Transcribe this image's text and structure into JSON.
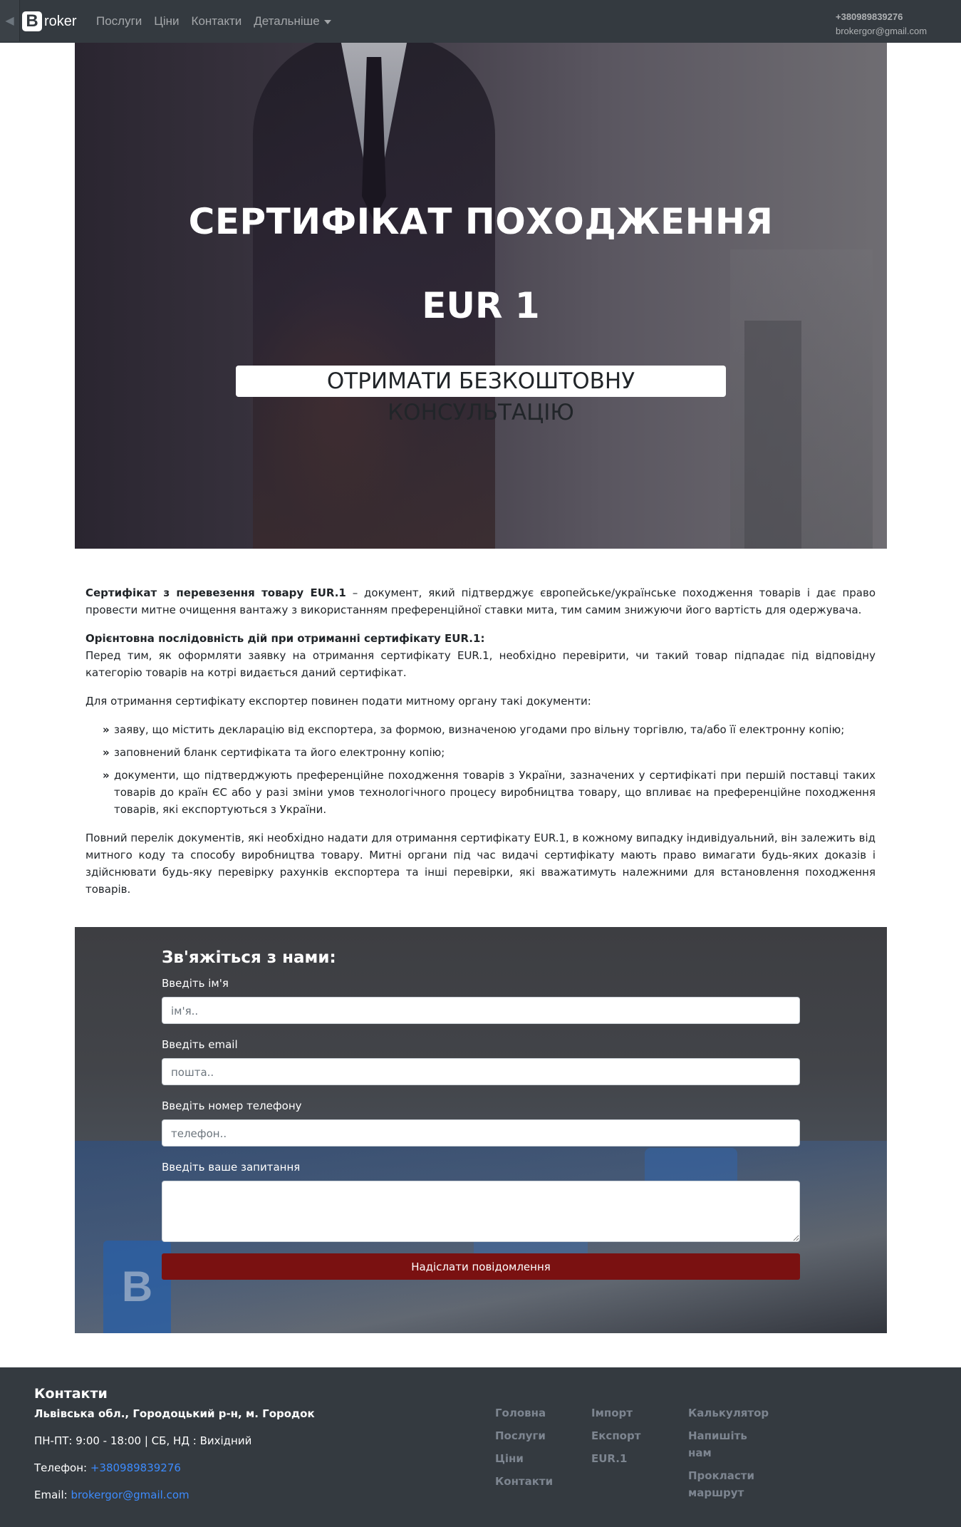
{
  "navbar": {
    "back_icon": "back-arrow-icon",
    "brand_letter": "B",
    "brand_text": "roker",
    "links": [
      "Послуги",
      "Ціни",
      "Контакти",
      "Детальніше"
    ],
    "phone": "+380989839276",
    "email": "brokergor@gmail.com"
  },
  "hero": {
    "title": "СЕРТИФІКАТ ПОХОДЖЕННЯ",
    "subtitle": "EUR 1",
    "cta": "ОТРИМАТИ БЕЗКОШТОВНУ КОНСУЛЬТАЦІЮ"
  },
  "article": {
    "intro_bold": "Сертифікат з перевезення товару EUR.1",
    "intro_text": " – документ, який підтверджує європейське/українське походження товарів і дає право провести митне очищення вантажу з використанням преференційної ставки мита, тим самим знижуючи його вартість для одержувача.",
    "sequence_heading": "Орієнтовна послідовність дій при отриманні сертифікату EUR.1:",
    "p1": "Перед тим, як оформляти заявку на отримання сертифікату EUR.1, необхідно перевірити, чи такий товар підпадає під відповідну категорію товарів на котрі видається даний сертифікат.",
    "p2": "Для отримання сертифікату експортер повинен подати митному органу такі документи:",
    "list": [
      "заяву, що містить декларацію від експортера, за формою, визначеною угодами про вільну торгівлю, та/або її електронну копію;",
      "заповнений бланк сертифіката та його електронну копію;",
      "документи, що підтверджують преференційне походження товарів з України, зазначених у сертифікаті при першій поставці таких товарів до країн ЄС або у разі зміни умов технологічного процесу виробництва товару, що впливає на преференційне походження товарів, які експортуються з України."
    ],
    "p3": "Повний перелік документів, які необхідно надати для отримання сертифікату EUR.1, в кожному випадку індивідуальний, він залежить від митного коду та способу виробництва товару. Митні органи під час видачі сертифікату мають право вимагати будь-яких доказів і здійснювати будь-яку перевірку рахунків експортера та інші перевірки, які вважатимуть належними для встановлення походження товарів."
  },
  "form": {
    "title": "Зв'яжіться з нами:",
    "name_label": "Введіть ім'я",
    "name_placeholder": "ім'я..",
    "email_label": "Введіть email",
    "email_placeholder": "пошта..",
    "phone_label": "Введіть номер телефону",
    "phone_placeholder": "телефон..",
    "question_label": "Введіть ваше запитання",
    "submit": "Надіслати повідомлення"
  },
  "footer": {
    "title": "Контакти",
    "address": "Львівська обл., Городоцький р-н, м. Городок",
    "hours": "ПН-ПТ: 9:00 - 18:00 | СБ, НД : Вихідний",
    "phone_label": "Телефон: ",
    "phone": "+380989839276",
    "email_label": "Email: ",
    "email": "brokergor@gmail.com",
    "col1": [
      "Головна",
      "Послуги",
      "Ціни",
      "Контакти"
    ],
    "col2": [
      "Імпорт",
      "Експорт",
      "EUR.1"
    ],
    "col3": [
      "Калькулятор",
      "Напишіть нам",
      "Прокласти маршрут"
    ]
  },
  "colors": {
    "navbar": "#343a40",
    "submit": "#7a1111",
    "link": "#3d8bfd"
  }
}
